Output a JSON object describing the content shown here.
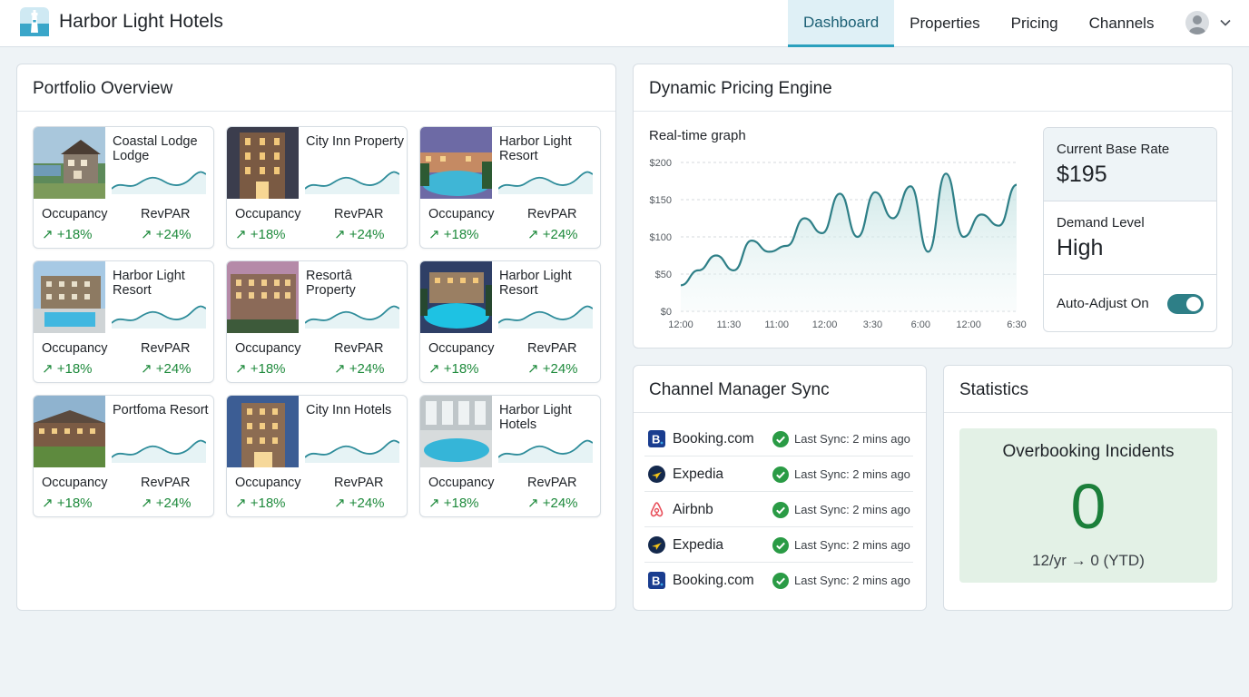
{
  "header": {
    "app_title": "Harbor Light Hotels",
    "logo_icon": "lighthouse-icon",
    "nav": [
      {
        "label": "Dashboard",
        "active": true
      },
      {
        "label": "Properties",
        "active": false
      },
      {
        "label": "Pricing",
        "active": false
      },
      {
        "label": "Channels",
        "active": false
      }
    ],
    "user_icon": "user-avatar-icon",
    "menu_icon": "chevron-down-icon"
  },
  "portfolio": {
    "title": "Portfolio Overview",
    "properties": [
      {
        "name": "Coastal Lodge Lodge",
        "occupancy_label": "Occupancy",
        "occupancy": "↗ +18%",
        "revpar_label": "RevPAR",
        "revpar": "↗ +24%"
      },
      {
        "name": "City Inn Property",
        "occupancy_label": "Occupancy",
        "occupancy": "↗ +18%",
        "revpar_label": "RevPAR",
        "revpar": "↗ +24%"
      },
      {
        "name": "Harbor Light Resort",
        "occupancy_label": "Occupancy",
        "occupancy": "↗ +18%",
        "revpar_label": "RevPAR",
        "revpar": "↗ +24%"
      },
      {
        "name": "Harbor Light Resort",
        "occupancy_label": "Occupancy",
        "occupancy": "↗ +18%",
        "revpar_label": "RevPAR",
        "revpar": "↗ +24%"
      },
      {
        "name": "Resortâ Property",
        "occupancy_label": "Occupancy",
        "occupancy": "↗ +18%",
        "revpar_label": "RevPAR",
        "revpar": "↗ +24%"
      },
      {
        "name": "Harbor Light Resort",
        "occupancy_label": "Occupancy",
        "occupancy": "↗ +18%",
        "revpar_label": "RevPAR",
        "revpar": "↗ +24%"
      },
      {
        "name": "Portfoma Resort",
        "occupancy_label": "Occupancy",
        "occupancy": "↗ +18%",
        "revpar_label": "RevPAR",
        "revpar": "↗ +24%"
      },
      {
        "name": "City Inn Hotels",
        "occupancy_label": "Occupancy",
        "occupancy": "↗ +18%",
        "revpar_label": "RevPAR",
        "revpar": "↗ +24%"
      },
      {
        "name": "Harbor Light Hotels",
        "occupancy_label": "Occupancy",
        "occupancy": "↗ +18%",
        "revpar_label": "RevPAR",
        "revpar": "↗ +24%"
      }
    ]
  },
  "pricing": {
    "title": "Dynamic Pricing Engine",
    "graph_label": "Real-time graph",
    "base_rate_label": "Current Base Rate",
    "base_rate": "$195",
    "demand_label": "Demand Level",
    "demand": "High",
    "auto_adjust_label": "Auto-Adjust On",
    "auto_adjust_on": true
  },
  "chart_data": {
    "type": "area",
    "title": "Real-time graph",
    "y_ticks": [
      "$200",
      "$150",
      "$100",
      "$50",
      "$0"
    ],
    "ylim": [
      0,
      200
    ],
    "x_ticks": [
      "12:00",
      "11:30",
      "11:00",
      "12:00",
      "3:30",
      "6:00",
      "12:00",
      "6:30"
    ],
    "points": [
      35,
      55,
      75,
      55,
      95,
      80,
      88,
      125,
      105,
      158,
      100,
      160,
      125,
      168,
      80,
      185,
      100,
      130,
      115,
      170
    ],
    "grid": true,
    "color": "#2e7f87"
  },
  "channels": {
    "title": "Channel Manager Sync",
    "items": [
      {
        "name": "Booking.com",
        "icon": "booking-icon",
        "sync": "Last Sync: 2 mins ago"
      },
      {
        "name": "Expedia",
        "icon": "expedia-icon",
        "sync": "Last Sync: 2 mins ago"
      },
      {
        "name": "Airbnb",
        "icon": "airbnb-icon",
        "sync": "Last Sync: 2 mins ago"
      },
      {
        "name": "Expedia",
        "icon": "expedia-icon",
        "sync": "Last Sync: 2 mins ago"
      },
      {
        "name": "Booking.com",
        "icon": "booking-icon",
        "sync": "Last Sync: 2 mins ago"
      }
    ]
  },
  "statistics": {
    "title": "Statistics",
    "card_title": "Overbooking Incidents",
    "value": "0",
    "subtext": "12/yr → 0 (YTD)"
  }
}
